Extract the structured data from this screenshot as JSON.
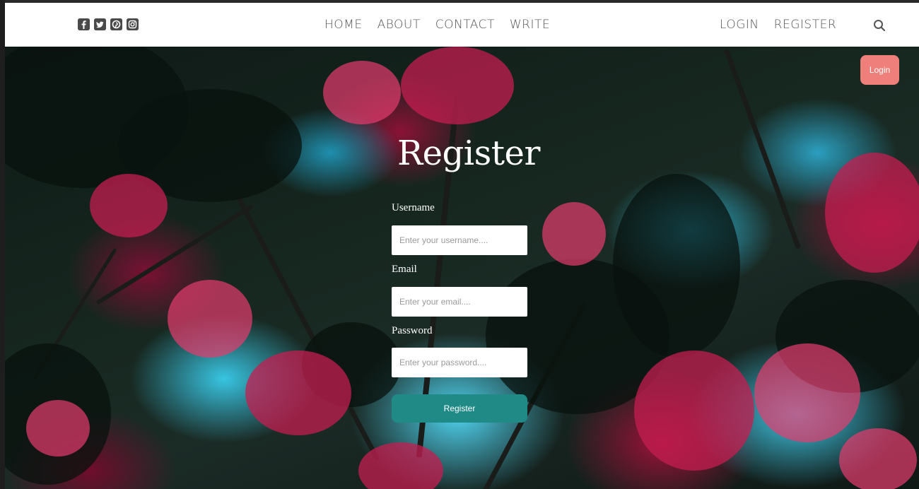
{
  "nav": {
    "social": [
      {
        "icon": "facebook-icon",
        "glyph": "f"
      },
      {
        "icon": "twitter-icon",
        "glyph": "t"
      },
      {
        "icon": "pinterest-icon",
        "glyph": "p"
      },
      {
        "icon": "instagram-icon",
        "glyph": "◎"
      }
    ],
    "links": [
      "HOME",
      "ABOUT",
      "CONTACT",
      "WRITE"
    ],
    "auth": [
      "LOGIN",
      "REGISTER"
    ]
  },
  "login_button": "Login",
  "form": {
    "title": "Register",
    "username_label": "Username",
    "username_placeholder": "Enter your username....",
    "email_label": "Email",
    "email_placeholder": "Enter your email....",
    "password_label": "Password",
    "password_placeholder": "Enter your password....",
    "submit": "Register"
  },
  "colors": {
    "login_button": "#ef7f7a",
    "register_button": "#1f8a86",
    "nav_text": "#555555"
  }
}
